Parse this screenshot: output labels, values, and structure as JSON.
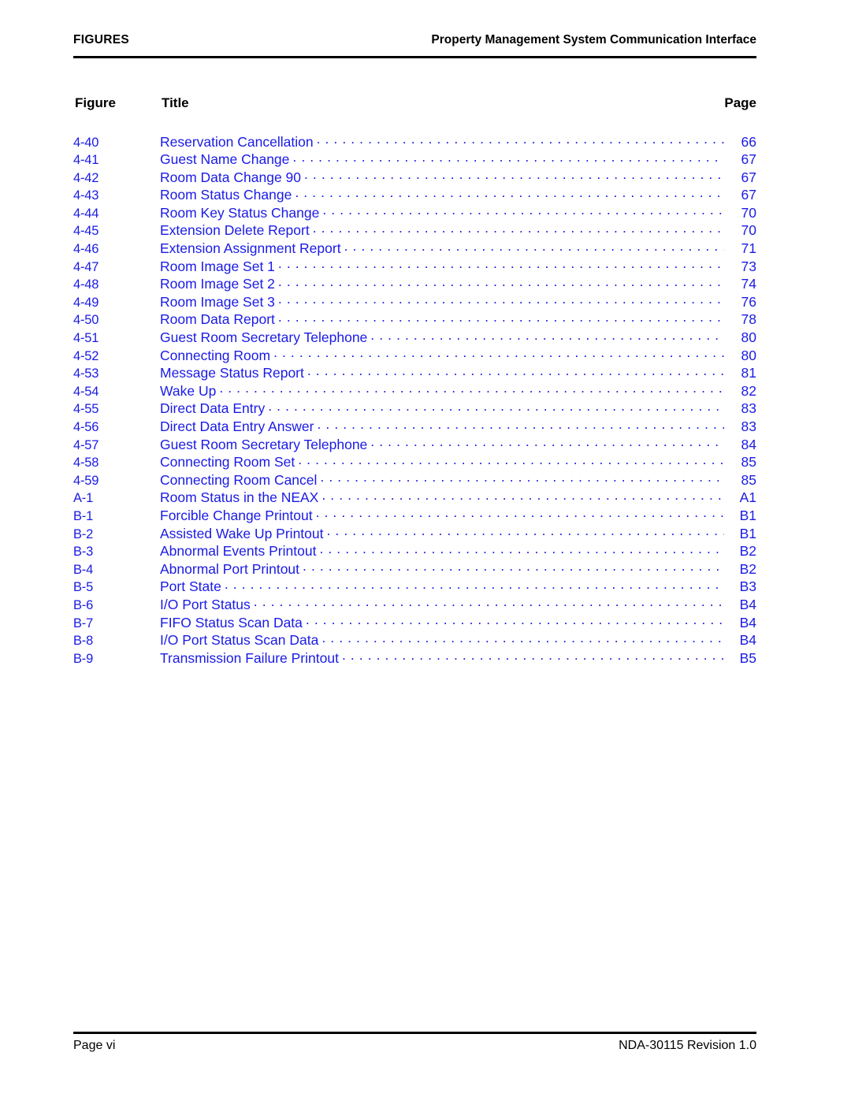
{
  "header": {
    "left_label": "FIGURES",
    "document_title": "Property Management System Communication Interface"
  },
  "columns": {
    "figure": "Figure",
    "title": "Title",
    "page": "Page"
  },
  "colors": {
    "entry_blue": "#1A1AE6",
    "text_black": "#000000",
    "rule_black": "#000000"
  },
  "entries": [
    {
      "num": "4-40",
      "title": "Reservation Cancellation",
      "page": "66"
    },
    {
      "num": "4-41",
      "title": "Guest Name Change",
      "page": "67"
    },
    {
      "num": "4-42",
      "title": "Room Data Change 90",
      "page": "67"
    },
    {
      "num": "4-43",
      "title": "Room Status Change",
      "page": "67"
    },
    {
      "num": "4-44",
      "title": "Room Key Status Change",
      "page": "70"
    },
    {
      "num": "4-45",
      "title": "Extension Delete Report",
      "page": "70"
    },
    {
      "num": "4-46",
      "title": "Extension Assignment Report",
      "page": "71"
    },
    {
      "num": "4-47",
      "title": "Room Image Set 1",
      "page": "73"
    },
    {
      "num": "4-48",
      "title": "Room Image Set 2",
      "page": "74"
    },
    {
      "num": "4-49",
      "title": "Room Image Set 3",
      "page": "76"
    },
    {
      "num": "4-50",
      "title": "Room Data Report",
      "page": "78"
    },
    {
      "num": "4-51",
      "title": "Guest Room Secretary Telephone",
      "page": "80"
    },
    {
      "num": "4-52",
      "title": "Connecting Room",
      "page": "80"
    },
    {
      "num": "4-53",
      "title": "Message Status Report",
      "page": "81"
    },
    {
      "num": "4-54",
      "title": "Wake Up",
      "page": "82"
    },
    {
      "num": "4-55",
      "title": "Direct Data Entry",
      "page": "83"
    },
    {
      "num": "4-56",
      "title": "Direct Data Entry Answer",
      "page": "83"
    },
    {
      "num": "4-57",
      "title": "Guest Room Secretary Telephone",
      "page": "84"
    },
    {
      "num": "4-58",
      "title": "Connecting Room Set",
      "page": "85"
    },
    {
      "num": "4-59",
      "title": "Connecting Room Cancel",
      "page": "85"
    },
    {
      "num": "A-1",
      "title": "Room Status in the NEAX",
      "page": "A1"
    },
    {
      "num": "B-1",
      "title": "Forcible Change Printout",
      "page": "B1"
    },
    {
      "num": "B-2",
      "title": "Assisted Wake Up Printout",
      "page": "B1"
    },
    {
      "num": "B-3",
      "title": "Abnormal Events Printout",
      "page": "B2"
    },
    {
      "num": "B-4",
      "title": "Abnormal Port Printout",
      "page": "B2"
    },
    {
      "num": "B-5",
      "title": "Port State",
      "page": "B3"
    },
    {
      "num": "B-6",
      "title": "I/O Port Status",
      "page": "B4"
    },
    {
      "num": "B-7",
      "title": "FIFO Status Scan Data",
      "page": "B4"
    },
    {
      "num": "B-8",
      "title": "I/O Port Status Scan Data",
      "page": "B4"
    },
    {
      "num": "B-9",
      "title": "Transmission Failure Printout",
      "page": "B5"
    }
  ],
  "footer": {
    "left": "Page vi",
    "right": "NDA-30115 Revision 1.0"
  }
}
